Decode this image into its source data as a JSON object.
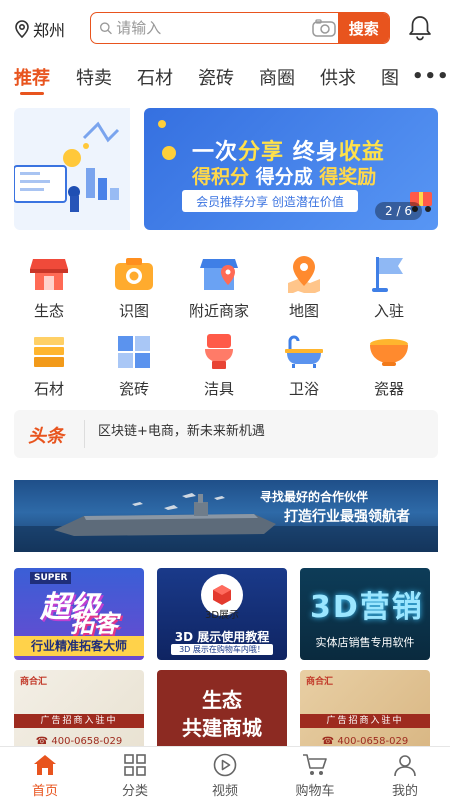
{
  "header": {
    "location": "郑州",
    "search_placeholder": "请输入",
    "search_button": "搜索"
  },
  "tabs": [
    "推荐",
    "特卖",
    "石材",
    "瓷砖",
    "商圈",
    "供求",
    "图"
  ],
  "banner": {
    "line1_a": "一次",
    "line1_b": "分享",
    "line1_c": " 终身",
    "line1_d": "收益",
    "line2_a": "得积分",
    "line2_b": "得分成",
    "line2_c": "得奖励",
    "sub": "会员推荐分享 创造潜在价值",
    "pager": "2 / 6"
  },
  "grid": [
    {
      "label": "生态",
      "icon": "shop-icon"
    },
    {
      "label": "识图",
      "icon": "camera-icon"
    },
    {
      "label": "附近商家",
      "icon": "nearby-store-icon"
    },
    {
      "label": "地图",
      "icon": "map-pin-icon"
    },
    {
      "label": "入驻",
      "icon": "flag-icon"
    },
    {
      "label": "石材",
      "icon": "stone-icon"
    },
    {
      "label": "瓷砖",
      "icon": "tile-icon"
    },
    {
      "label": "洁具",
      "icon": "toilet-icon"
    },
    {
      "label": "卫浴",
      "icon": "bathtub-icon"
    },
    {
      "label": "瓷器",
      "icon": "bowl-icon"
    }
  ],
  "news": {
    "title": "头条",
    "text": "区块链+电商，新未来新机遇"
  },
  "ad": {
    "line1": "寻找最好的合作伙伴",
    "line2": "打造行业最强领航者"
  },
  "cards": [
    {
      "super": "SUPER",
      "t1": "超级",
      "t2": "拓客",
      "bottom": "行业精准拓客大师"
    },
    {
      "tag": "3D展示",
      "t1": "3D 展示使用教程",
      "bottom": "3D 展示在购物车内哦！"
    },
    {
      "t1": "3D营销",
      "bottom": "实体店销售专用软件"
    },
    {
      "brand": "商合汇",
      "strip": "广告招商入驻中",
      "phone": "☎ 400-0658-029"
    },
    {
      "t1": "生态",
      "t2": "共建商城"
    },
    {
      "brand": "商合汇",
      "strip": "广告招商入驻中",
      "phone": "☎ 400-0658-029"
    }
  ],
  "bottom_nav": [
    "首页",
    "分类",
    "视频",
    "购物车",
    "我的"
  ],
  "colors": {
    "accent": "#e8541e",
    "banner_blue": "#3570e0"
  }
}
